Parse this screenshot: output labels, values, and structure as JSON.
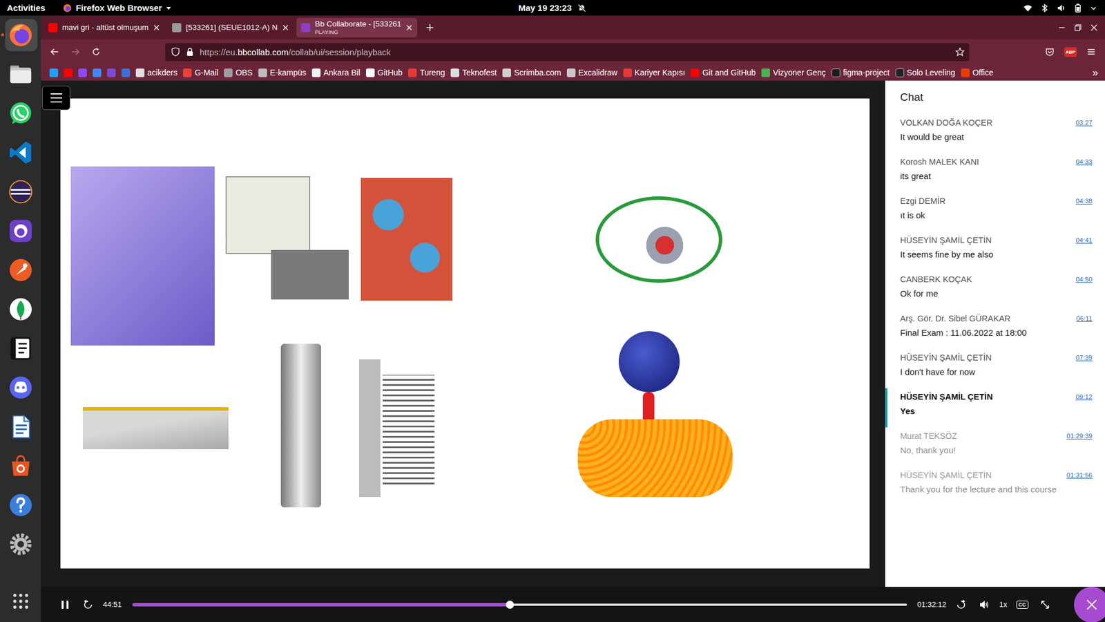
{
  "topbar": {
    "activities": "Activities",
    "app": "Firefox Web Browser",
    "clock": "May 19  23:23",
    "do_not_disturb": true
  },
  "dock": {
    "items": [
      {
        "kind": "firefox",
        "active": true
      },
      {
        "kind": "files",
        "active": false
      },
      {
        "kind": "whatsapp",
        "active": false
      },
      {
        "kind": "vscode",
        "active": false
      },
      {
        "kind": "eclipse",
        "active": false
      },
      {
        "kind": "github",
        "active": false
      },
      {
        "kind": "postman",
        "active": false
      },
      {
        "kind": "mongodb",
        "active": false
      },
      {
        "kind": "notion",
        "active": false
      },
      {
        "kind": "discord",
        "active": false
      },
      {
        "kind": "writer",
        "active": false
      },
      {
        "kind": "software",
        "active": false
      },
      {
        "kind": "help",
        "active": false
      },
      {
        "kind": "settings",
        "active": false
      }
    ]
  },
  "tabs": [
    {
      "label": "mavi gri - altüst olmuşum",
      "selected": false,
      "color": "#ff0000"
    },
    {
      "label": "[533261] (SEUE1012-A) N",
      "selected": false,
      "color": "#9a9a9a"
    },
    {
      "label": "Bb Collaborate - [533261",
      "status": "PLAYING",
      "selected": true,
      "color": "#8a3fc2"
    }
  ],
  "navigation": {
    "forward_enabled": false
  },
  "url": {
    "prefix": "https://eu.",
    "domain": "bbcollab.com",
    "path": "/collab/ui/session/playback"
  },
  "adblock_badge": "ABP",
  "bookmarks": {
    "items": [
      {
        "color": "#1da1f2"
      },
      {
        "color": "#ff0000"
      },
      {
        "color": "#9146ff"
      },
      {
        "color": "#4285f4"
      },
      {
        "color": "#7b4bd6"
      },
      {
        "color": "#3b6fd8"
      },
      {
        "label": "acikders",
        "color": "#e0e0e0"
      },
      {
        "label": "G-Mail",
        "color": "#ea4335"
      },
      {
        "label": "OBS",
        "color": "#9e9e9e"
      },
      {
        "label": "E-kampüs",
        "color": "#bdbdbd"
      },
      {
        "label": "Ankara Bil",
        "color": "#f2f2f2"
      },
      {
        "label": "GitHub",
        "color": "#ffffff"
      },
      {
        "label": "Tureng",
        "color": "#e53935"
      },
      {
        "label": "Teknofest",
        "color": "#dddddd"
      },
      {
        "label": "Scrimba.com",
        "color": "#cfcfcf"
      },
      {
        "label": "Excalidraw",
        "color": "#c8c8c8"
      },
      {
        "label": "Kariyer Kapısı",
        "color": "#e53935"
      },
      {
        "label": "Git and GitHub",
        "color": "#ff0000"
      },
      {
        "label": "Vizyoner Genç",
        "color": "#4caf50"
      },
      {
        "label": "figma-project",
        "color": "#1e1e1e"
      },
      {
        "label": "Solo Leveling",
        "color": "#222222"
      },
      {
        "label": "Office",
        "color": "#eb3c00"
      }
    ],
    "overflow": "»"
  },
  "player": {
    "elapsed": "44:51",
    "duration": "01:32:12",
    "level": 0.488,
    "speed": "1x",
    "captions": "CC",
    "playing": true
  },
  "chat": {
    "title": "Chat",
    "messages": [
      {
        "author": "VOLKAN DOĞA KOÇER",
        "time": "03:27",
        "text": "It would be great",
        "selected": false,
        "dimmed": false
      },
      {
        "author": "Korosh MALEK KANI",
        "time": "04:33",
        "text": "its great",
        "selected": false,
        "dimmed": false
      },
      {
        "author": "Ezgi DEMİR",
        "time": "04:38",
        "text": "ıt is ok",
        "selected": false,
        "dimmed": false
      },
      {
        "author": "HÜSEYİN ŞAMİL ÇETİN",
        "time": "04:41",
        "text": "It seems fine by me also",
        "selected": false,
        "dimmed": false
      },
      {
        "author": "CANBERK KOÇAK",
        "time": "04:50",
        "text": "Ok for me",
        "selected": false,
        "dimmed": false
      },
      {
        "author": "Arş. Gör. Dr. Sibel GÜRAKAR",
        "time": "06:11",
        "text": "Final Exam : 11.06.2022 at 18:00",
        "selected": false,
        "dimmed": false
      },
      {
        "author": "HÜSEYİN ŞAMİL ÇETİN",
        "time": "07:39",
        "text": "I don't have for now",
        "selected": false,
        "dimmed": false
      },
      {
        "author": "HÜSEYİN ŞAMİL ÇETİN",
        "time": "09:12",
        "text": "Yes",
        "selected": true,
        "dimmed": false
      },
      {
        "author": "Murat TEKSÖZ",
        "time": "01:29:39",
        "text": "No, thank you!",
        "selected": false,
        "dimmed": true
      },
      {
        "author": "HÜSEYİN ŞAMİL ÇETİN",
        "time": "01:31:56",
        "text": "Thank you for the lecture and this course",
        "selected": false,
        "dimmed": true
      }
    ]
  }
}
